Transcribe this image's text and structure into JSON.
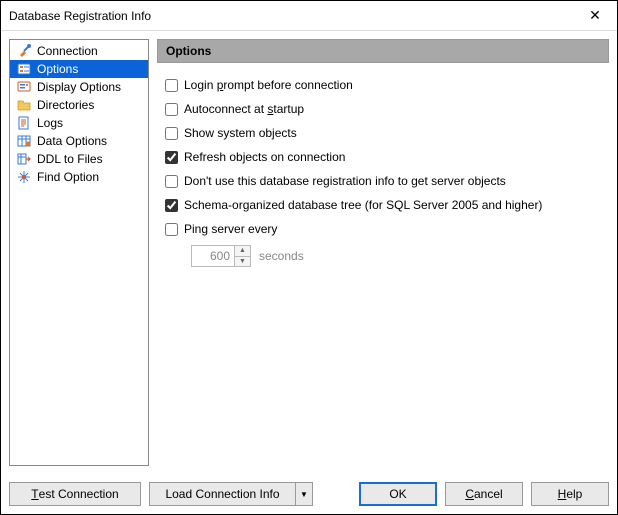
{
  "window": {
    "title": "Database Registration Info"
  },
  "sidebar": {
    "items": [
      {
        "label": "Connection"
      },
      {
        "label": "Options"
      },
      {
        "label": "Display Options"
      },
      {
        "label": "Directories"
      },
      {
        "label": "Logs"
      },
      {
        "label": "Data Options"
      },
      {
        "label": "DDL to Files"
      },
      {
        "label": "Find Option"
      }
    ]
  },
  "main": {
    "header": "Options",
    "opts": {
      "login_before": "Login ",
      "login_u": "p",
      "login_after": "rompt before connection",
      "auto_before": "Autoconnect at ",
      "auto_u": "s",
      "auto_after": "tartup",
      "sys_full": "Show system objects",
      "refresh_full": "Refresh objects on connection",
      "dontuse_full": "Don't use this database registration info to get server objects",
      "schema_full": "Schema-organized database tree (for SQL Server 2005 and higher)",
      "ping_full": "Ping server every",
      "ping_value": "600",
      "seconds": "seconds"
    }
  },
  "footer": {
    "test_before": "",
    "test_u": "T",
    "test_after": "est Connection",
    "load": "Load Connection Info",
    "ok": "OK",
    "cancel_u": "C",
    "cancel_after": "ancel",
    "help_u": "H",
    "help_after": "elp"
  }
}
